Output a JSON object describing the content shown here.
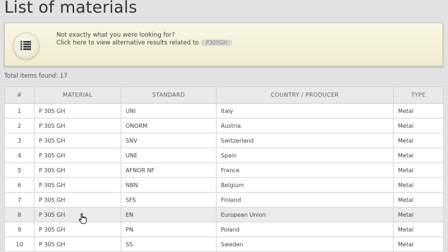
{
  "page": {
    "title": "List of materials"
  },
  "banner": {
    "line1": "Not exactly what you were looking for?",
    "line2": "Click here to view alternative results related to",
    "tag": "P305GH",
    "icon": "list-icon"
  },
  "total": "Total items found: 17",
  "table": {
    "headers": [
      "#",
      "MATERIAL",
      "STANDARD",
      "COUNTRY / PRODUCER",
      "TYPE"
    ],
    "rows": [
      [
        "1",
        "P 305 GH",
        "UNI",
        "Italy",
        "Metal"
      ],
      [
        "2",
        "P 305 GH",
        "ONORM",
        "Austria",
        "Metal"
      ],
      [
        "3",
        "P 305 GH",
        "SNV",
        "Switzerland",
        "Metal"
      ],
      [
        "4",
        "P 305 GH",
        "UNE",
        "Spain",
        "Metal"
      ],
      [
        "5",
        "P 305 GH",
        "AFNOR NF",
        "France",
        "Metal"
      ],
      [
        "6",
        "P 305 GH",
        "NBN",
        "Belgium",
        "Metal"
      ],
      [
        "7",
        "P 305 GH",
        "SFS",
        "Finland",
        "Metal"
      ],
      [
        "8",
        "P 305 GH",
        "EN",
        "European Union",
        "Metal"
      ],
      [
        "9",
        "P 305 GH",
        "PN",
        "Poland",
        "Metal"
      ],
      [
        "10",
        "P 305 GH",
        "SS",
        "Sweden",
        "Metal"
      ]
    ],
    "highlighted_row": 8
  },
  "cursor": {
    "icon": "hand-pointer-icon"
  }
}
